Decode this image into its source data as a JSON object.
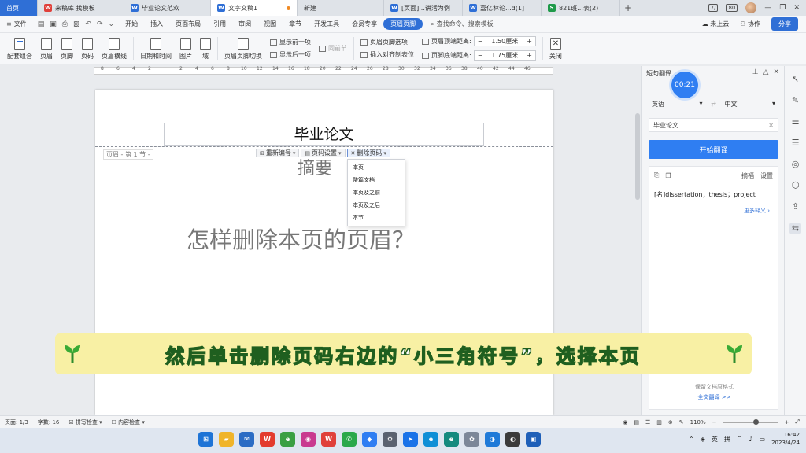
{
  "tabs": [
    {
      "label": "首页",
      "type": "home"
    },
    {
      "label": "来稿库 找模板",
      "color": "#e0403a",
      "glyph": "W"
    },
    {
      "label": "毕业论文范欢",
      "color": "#2f6fd6",
      "glyph": "W"
    },
    {
      "label": "文字文稿1",
      "color": "#2f6fd6",
      "glyph": "W",
      "active": true
    },
    {
      "label": "新建",
      "color": "#2f6fd6",
      "glyph": ""
    },
    {
      "label": "[页面]...讲活为例",
      "color": "#2f6fd6",
      "glyph": "W"
    },
    {
      "label": "嘉亿林论...d(1]",
      "color": "#2f6fd6",
      "glyph": "W"
    },
    {
      "label": "821班...表(2)",
      "color": "#1f9a4a",
      "glyph": "S"
    }
  ],
  "window": {
    "badge": "7/",
    "badge2": "80"
  },
  "menu": {
    "file": "文件",
    "items": [
      "开始",
      "插入",
      "页面布局",
      "引用",
      "审阅",
      "视图",
      "章节",
      "开发工具",
      "会员专享"
    ],
    "active": "页眉页脚",
    "search": "查找命令、搜索模板",
    "cloud": "未上云",
    "collab": "协作",
    "share": "分享"
  },
  "toolbar": {
    "buttons1": [
      "配套组合",
      "页眉",
      "页脚",
      "页码",
      "页眉横线"
    ],
    "buttons2": [
      "日期和时间",
      "图片",
      "域"
    ],
    "switch": "页眉页脚切换",
    "show_prev": "显示前一项",
    "show_next": "显示后一项",
    "same_prev": "同前节",
    "options": "页眉页脚选项",
    "insert_align": "插入对齐制表位",
    "header_top_label": "页眉顶端距离:",
    "header_top_value": "1.50厘米",
    "footer_bottom_label": "页脚底端距离:",
    "footer_bottom_value": "1.75厘米",
    "close": "关闭"
  },
  "ruler_numbers": [
    "8",
    "6",
    "4",
    "2",
    "2",
    "4",
    "6",
    "8",
    "10",
    "12",
    "14",
    "16",
    "18",
    "20",
    "22",
    "24",
    "26",
    "28",
    "30",
    "32",
    "34",
    "36",
    "38",
    "40",
    "42",
    "44",
    "46"
  ],
  "document": {
    "header_text": "毕业论文",
    "header_tag": "页眉 - 第 1 节 -",
    "abstract": "摘要",
    "question": "怎样删除本页的页眉？",
    "pn_buttons": [
      "重新编号",
      "页码设置",
      "删除页码"
    ],
    "dropdown": [
      "本页",
      "整篇文档",
      "本页及之前",
      "本页及之后",
      "本节"
    ]
  },
  "translate": {
    "title": "短句翻译",
    "timer": "00:21",
    "source_lang": "英语",
    "target_lang": "中文",
    "input": "毕业论文",
    "button": "开始翻译",
    "copy_label": "摘福",
    "settings": "设置",
    "result": "[名]dissertation；thesis；project",
    "more": "更多释义",
    "format_note": "保留文档原格式",
    "full_translate": "全文翻译 >>"
  },
  "status": {
    "page": "页面: 1/3",
    "words": "字数: 16",
    "spell": "拼写检查",
    "content_check": "内容检查",
    "zoom": "110%"
  },
  "taskbar": {
    "ime": "英",
    "ime2": "拼",
    "time": "16:42",
    "date": "2023/4/24"
  },
  "caption": "然后单击删除页码右边的“小三角符号”，选择本页",
  "colors": {
    "accent": "#2f6fd6",
    "caption_bg": "#f8f0a4",
    "caption_stroke": "#1f5f1f"
  }
}
